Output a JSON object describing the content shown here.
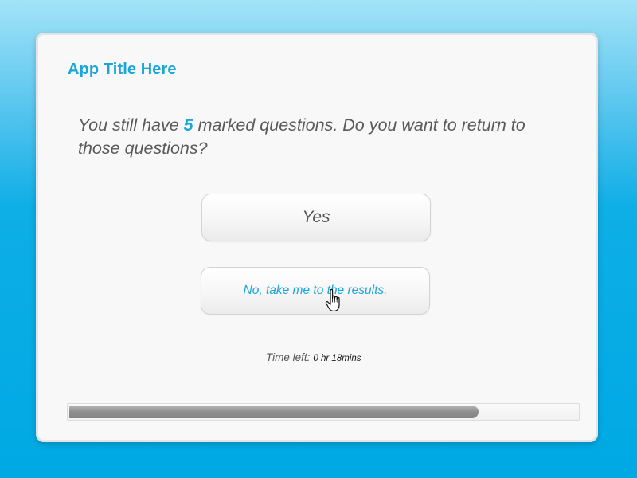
{
  "app": {
    "title": "App Title Here"
  },
  "dialog": {
    "question_prefix": "You still have ",
    "marked_count": "5",
    "question_suffix": " marked questions. Do you want to return to those questions?",
    "yes_label": "Yes",
    "no_label": "No, take me to the results.",
    "time_left_label": "Time left:",
    "time_left_value": "0 hr 18mins"
  },
  "progress": {
    "fraction": 0.805
  },
  "cursor": {
    "icon": "hand-pointer-icon"
  },
  "colors": {
    "accent": "#19a6dc",
    "background_top": "#a3e3f7",
    "background_bottom": "#00a9e4",
    "text": "#5a5a5a",
    "progress_fill": "#8e8e8e"
  }
}
